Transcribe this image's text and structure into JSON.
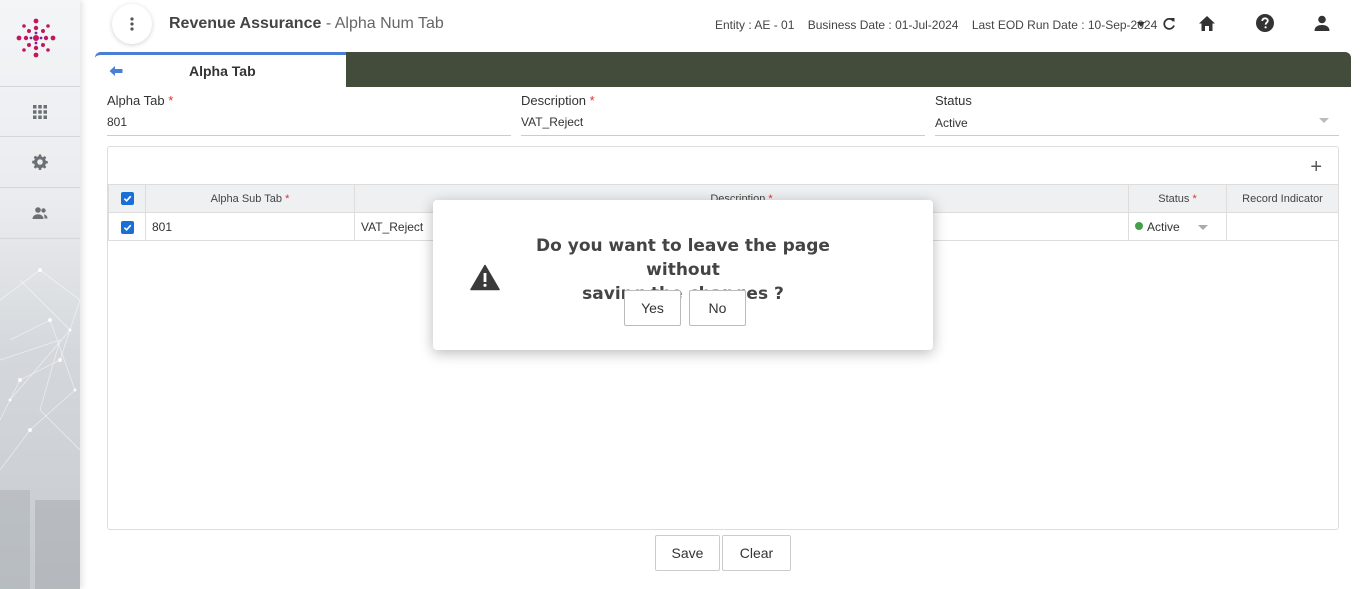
{
  "header": {
    "app_name": "Revenue Assurance",
    "separator": " - ",
    "page_name": "Alpha Num Tab",
    "entity": "Entity : AE - 01",
    "business_date": "Business Date : 01-Jul-2024",
    "last_eod": "Last EOD Run Date : 10-Sep-2024"
  },
  "tabs": {
    "active_label": "Alpha Tab"
  },
  "form": {
    "alpha_tab": {
      "label": "Alpha Tab",
      "required": "*",
      "value": "801"
    },
    "description": {
      "label": "Description",
      "required": "*",
      "value": "VAT_Reject"
    },
    "status": {
      "label": "Status",
      "value": "Active"
    }
  },
  "grid": {
    "add_label": "+",
    "columns": {
      "alpha_sub_tab": "Alpha Sub Tab",
      "description": "Description",
      "status": "Status",
      "record_indicator": "Record Indicator",
      "required": "*"
    },
    "rows": [
      {
        "alpha_sub_tab": "801",
        "description": "VAT_Reject",
        "status": "Active",
        "record_indicator": ""
      }
    ]
  },
  "footer": {
    "save": "Save",
    "clear": "Clear"
  },
  "modal": {
    "message_line1": "Do you want to leave the page without",
    "message_line2": "saving the changes ?",
    "yes": "Yes",
    "no": "No"
  },
  "colors": {
    "tabbar": "#434b3b",
    "accent": "#4a7fd6",
    "checkbox": "#1a6fd6",
    "status_active": "#43a047",
    "required": "#d9342b"
  }
}
